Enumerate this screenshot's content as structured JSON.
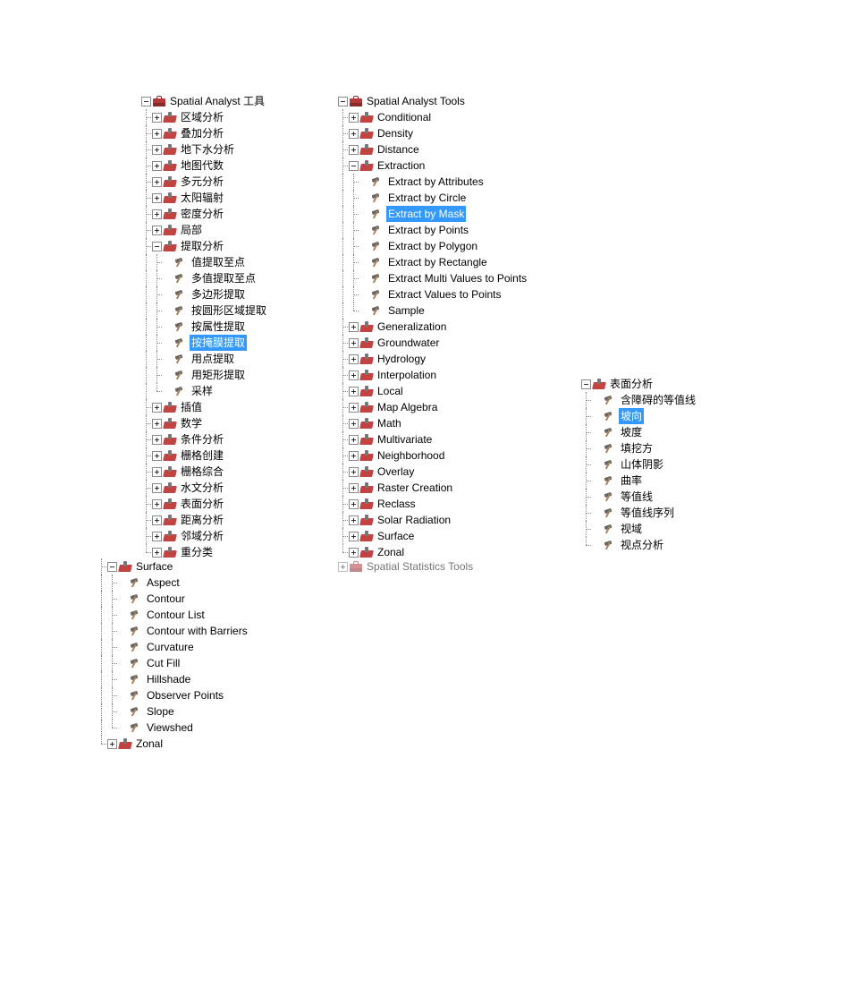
{
  "panel_cn": {
    "root": "Spatial Analyst 工具",
    "toolsets_before": [
      "区域分析",
      "叠加分析",
      "地下水分析",
      "地图代数",
      "多元分析",
      "太阳辐射",
      "密度分析",
      "局部"
    ],
    "extraction": {
      "label": "提取分析",
      "tools": [
        "值提取至点",
        "多值提取至点",
        "多边形提取",
        "按圆形区域提取",
        "按属性提取",
        "按掩膜提取",
        "用点提取",
        "用矩形提取",
        "采样"
      ],
      "selected_index": 5
    },
    "toolsets_after": [
      "插值",
      "数学",
      "条件分析",
      "栅格创建",
      "栅格综合",
      "水文分析",
      "表面分析",
      "距离分析",
      "邻域分析",
      "重分类"
    ]
  },
  "panel_en": {
    "root": "Spatial Analyst Tools",
    "toolsets_before": [
      "Conditional",
      "Density",
      "Distance"
    ],
    "extraction": {
      "label": "Extraction",
      "tools": [
        "Extract by Attributes",
        "Extract by Circle",
        "Extract by Mask",
        "Extract by Points",
        "Extract by Polygon",
        "Extract by Rectangle",
        "Extract Multi Values to Points",
        "Extract Values to Points",
        "Sample"
      ],
      "selected_index": 2
    },
    "toolsets_after": [
      "Generalization",
      "Groundwater",
      "Hydrology",
      "Interpolation",
      "Local",
      "Map Algebra",
      "Math",
      "Multivariate",
      "Neighborhood",
      "Overlay",
      "Raster Creation",
      "Reclass",
      "Solar Radiation",
      "Surface",
      "Zonal"
    ],
    "next_root": "Spatial Statistics Tools"
  },
  "panel_surface_cn": {
    "root": "表面分析",
    "tools": [
      "含障碍的等值线",
      "坡向",
      "坡度",
      "填挖方",
      "山体阴影",
      "曲率",
      "等值线",
      "等值线序列",
      "视域",
      "视点分析"
    ],
    "selected_index": 1
  },
  "panel_surface_en": {
    "root": "Surface",
    "tools": [
      "Aspect",
      "Contour",
      "Contour List",
      "Contour with Barriers",
      "Curvature",
      "Cut Fill",
      "Hillshade",
      "Observer Points",
      "Slope",
      "Viewshed"
    ],
    "zonal": "Zonal"
  }
}
